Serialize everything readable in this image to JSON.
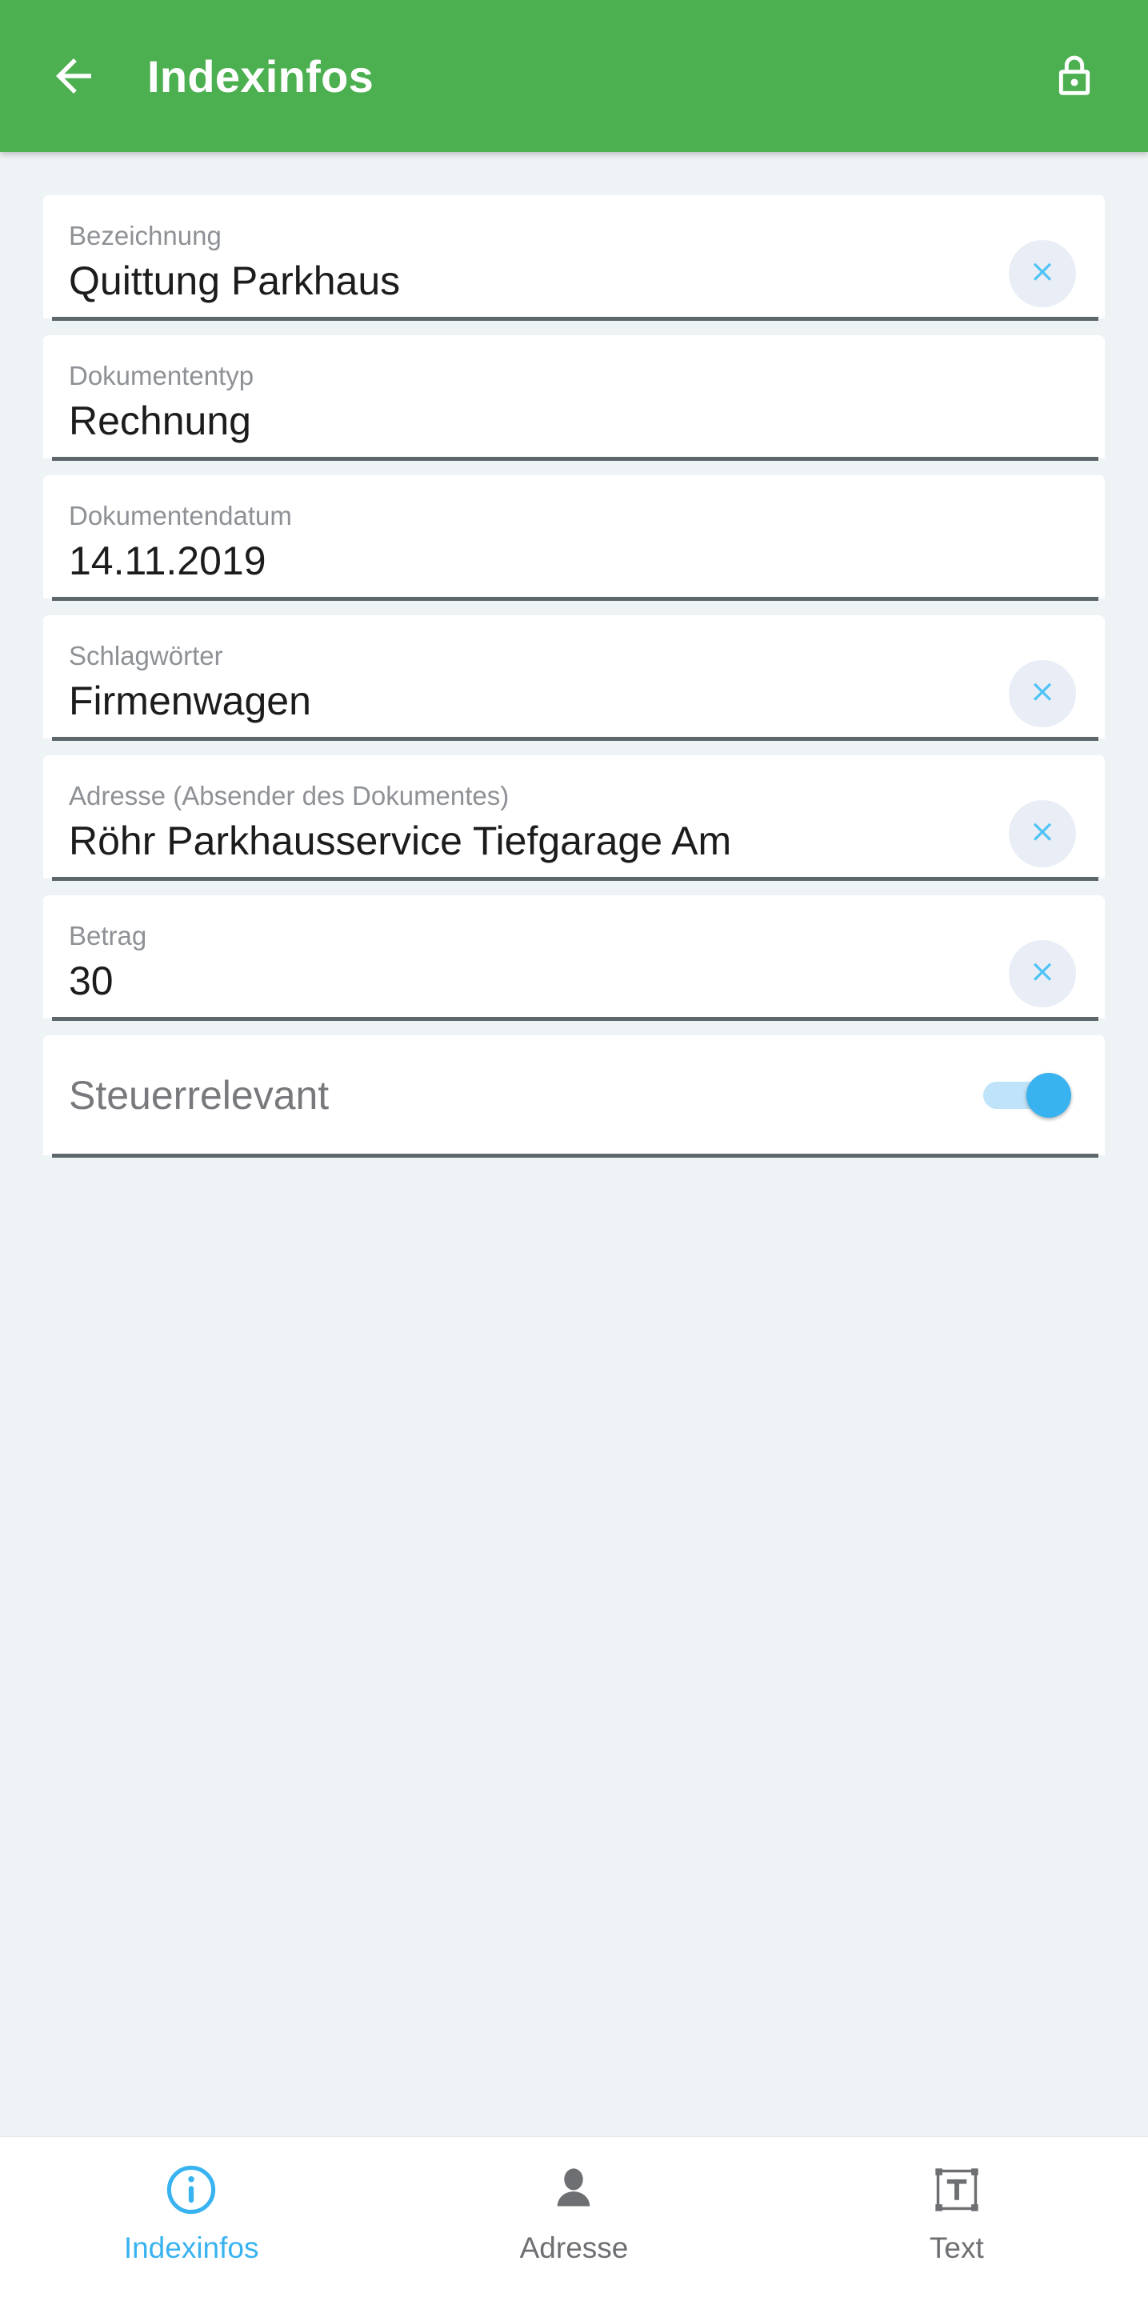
{
  "header": {
    "title": "Indexinfos",
    "back_icon": "arrow-left-icon",
    "lock_icon": "lock-closed-icon",
    "background_color": "#4caf50",
    "text_color": "#ffffff"
  },
  "theme": {
    "page_background": "#eef3f5",
    "card_background": "#ffffff",
    "underline_color": "#5e676c",
    "label_color": "#8e9195",
    "value_color": "#1c1c1c",
    "accent_color": "#38b3f0",
    "clear_button_background": "#e9edf6"
  },
  "form": {
    "fields": [
      {
        "label": "Bezeichnung",
        "value": "Quittung Parkhaus",
        "has_clear": true,
        "clear_icon": "close-icon"
      },
      {
        "label": "Dokumententyp",
        "value": "Rechnung",
        "has_clear": false,
        "clear_icon": ""
      },
      {
        "label": "Dokumentendatum",
        "value": "14.11.2019",
        "has_clear": false,
        "clear_icon": ""
      },
      {
        "label": "Schlagwörter",
        "value": "Firmenwagen",
        "has_clear": true,
        "clear_icon": "close-icon"
      },
      {
        "label": "Adresse (Absender des Dokumentes)",
        "value": "Röhr Parkhausservice Tiefgarage Am",
        "has_clear": true,
        "clear_icon": "close-icon"
      },
      {
        "label": "Betrag",
        "value": "30",
        "has_clear": true,
        "clear_icon": "close-icon"
      }
    ],
    "toggle": {
      "label": "Steuerrelevant",
      "state": "on",
      "track_color": "#bfe3f8",
      "thumb_color": "#38b3f0"
    }
  },
  "bottom_nav": {
    "items": [
      {
        "label": "Indexinfos",
        "icon": "info-circle-icon",
        "active": true
      },
      {
        "label": "Adresse",
        "icon": "person-icon",
        "active": false
      },
      {
        "label": "Text",
        "icon": "text-frame-icon",
        "active": false
      }
    ]
  }
}
